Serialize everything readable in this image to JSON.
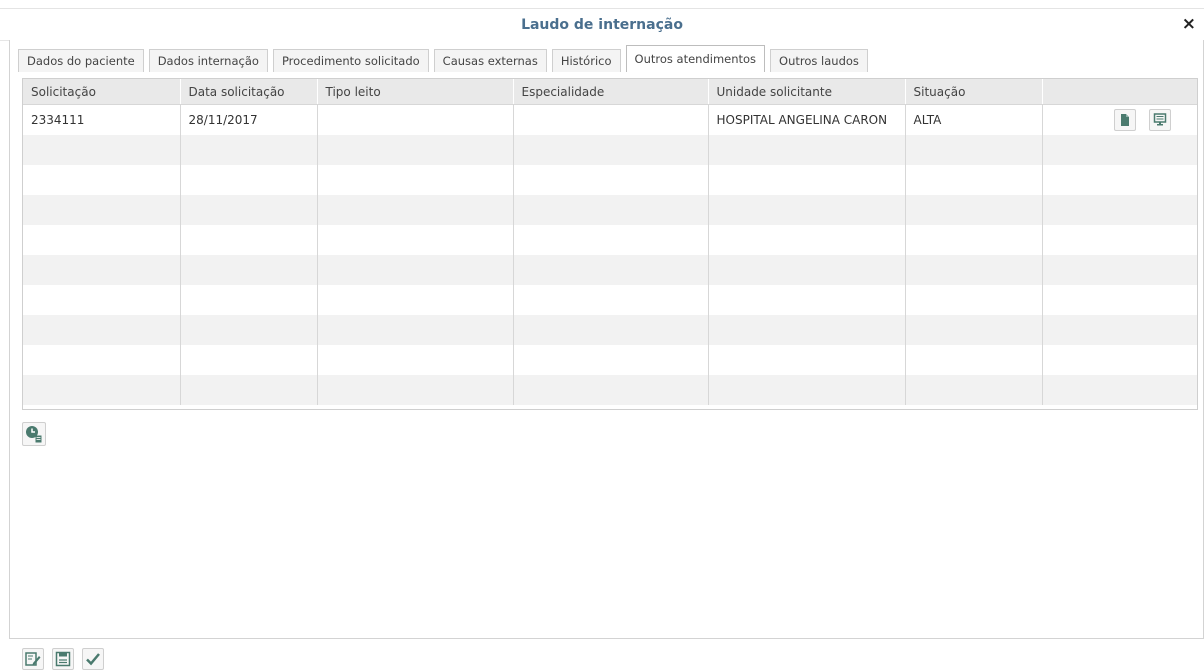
{
  "window": {
    "title": "Laudo de internação",
    "close_glyph": "×"
  },
  "tabs": [
    {
      "label": "Dados do paciente",
      "active": false
    },
    {
      "label": "Dados internação",
      "active": false
    },
    {
      "label": "Procedimento solicitado",
      "active": false
    },
    {
      "label": "Causas externas",
      "active": false
    },
    {
      "label": "Histórico",
      "active": false
    },
    {
      "label": "Outros atendimentos",
      "active": true
    },
    {
      "label": "Outros laudos",
      "active": false
    }
  ],
  "grid": {
    "columns": [
      "Solicitação",
      "Data solicitação",
      "Tipo leito",
      "Especialidade",
      "Unidade solicitante",
      "Situação",
      ""
    ],
    "rows": [
      {
        "solicitacao": "2334111",
        "data_solicitacao": "28/11/2017",
        "tipo_leito": "",
        "especialidade": "",
        "unidade_solicitante": "HOSPITAL ANGELINA CARON",
        "situacao": "ALTA",
        "actions": [
          "document-icon",
          "monitor-icon"
        ]
      }
    ],
    "empty_rows": 9
  },
  "below_grid_action": {
    "icon": "clock-list-icon"
  },
  "bottom_actions": [
    {
      "icon": "edit-icon"
    },
    {
      "icon": "save-icon"
    },
    {
      "icon": "check-icon"
    }
  ],
  "colors": {
    "accent": "#4a7a6e",
    "title": "#4a6f8e"
  }
}
